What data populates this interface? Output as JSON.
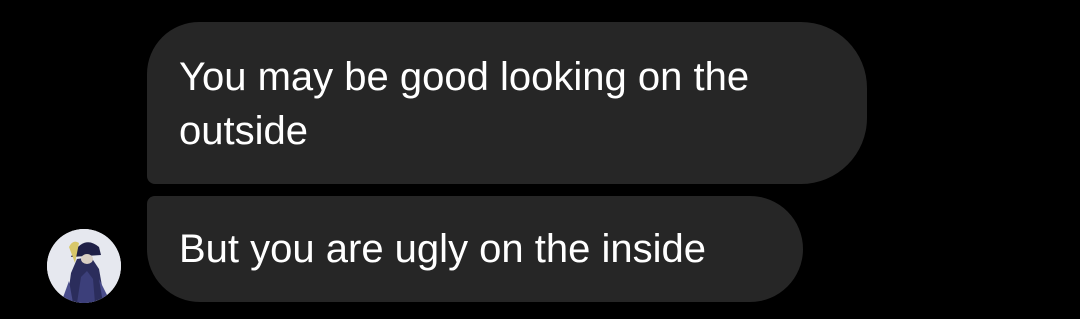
{
  "conversation": {
    "messages": [
      {
        "text": "You may be good looking on the outside"
      },
      {
        "text": "But you are ugly on the inside"
      }
    ],
    "sender": {
      "avatar_icon": "anime-character-avatar-icon"
    }
  },
  "colors": {
    "background": "#000000",
    "bubble": "#262626",
    "text": "#ffffff"
  }
}
